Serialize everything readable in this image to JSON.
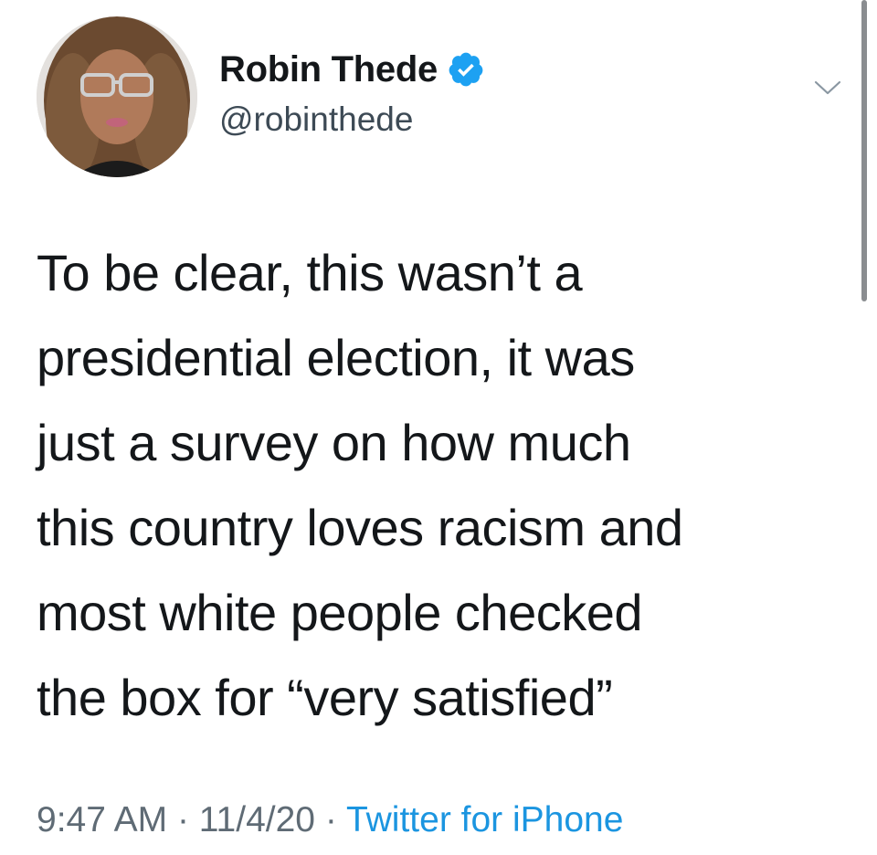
{
  "author": {
    "display_name": "Robin Thede",
    "handle": "@robinthede",
    "verified": true,
    "avatar_icon": "profile-photo"
  },
  "tweet": {
    "lines": [
      "To be clear, this wasn’t a",
      "presidential election, it was",
      "just a survey on how much",
      "this country loves racism and",
      "most white people checked",
      "the box for “very satisfied”"
    ]
  },
  "meta": {
    "time": "9:47 AM",
    "separator": "·",
    "date": "11/4/20",
    "source": "Twitter for iPhone"
  },
  "colors": {
    "verified_blue": "#1da1f2",
    "source_link": "#1b95e0",
    "text": "#14171a",
    "muted": "#5f6b75"
  },
  "icons": {
    "verified": "verified-badge-icon",
    "menu": "chevron-down-icon"
  }
}
